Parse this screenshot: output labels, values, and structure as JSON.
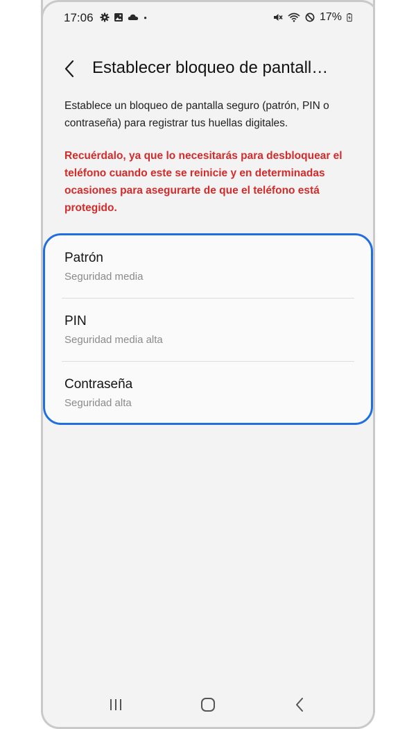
{
  "status_bar": {
    "time": "17:06",
    "battery": "17%",
    "left_icons": [
      "gear-icon",
      "image-icon",
      "cloud-icon",
      "dot-icon"
    ],
    "right_icons": [
      "mute-icon",
      "wifi-icon",
      "dnd-icon",
      "battery-icon"
    ]
  },
  "header": {
    "title": "Establecer bloqueo de pantall…"
  },
  "description": "Establece un bloqueo de pantalla seguro (patrón, PIN o contraseña) para registrar tus huellas digitales.",
  "warning": "Recuérdalo, ya que lo necesitarás para desbloquear el teléfono cuando este se reinicie y en determinadas ocasiones para asegurarte de que el teléfono está protegido.",
  "options": [
    {
      "title": "Patrón",
      "subtitle": "Seguridad media"
    },
    {
      "title": "PIN",
      "subtitle": "Seguridad media alta"
    },
    {
      "title": "Contraseña",
      "subtitle": "Seguridad alta"
    }
  ],
  "colors": {
    "accent_border": "#1f6fe0",
    "warning_text": "#d32b2b",
    "background": "#f3f3f3"
  },
  "navbar": {
    "icons": [
      "recents-icon",
      "home-icon",
      "back-nav-icon"
    ]
  }
}
